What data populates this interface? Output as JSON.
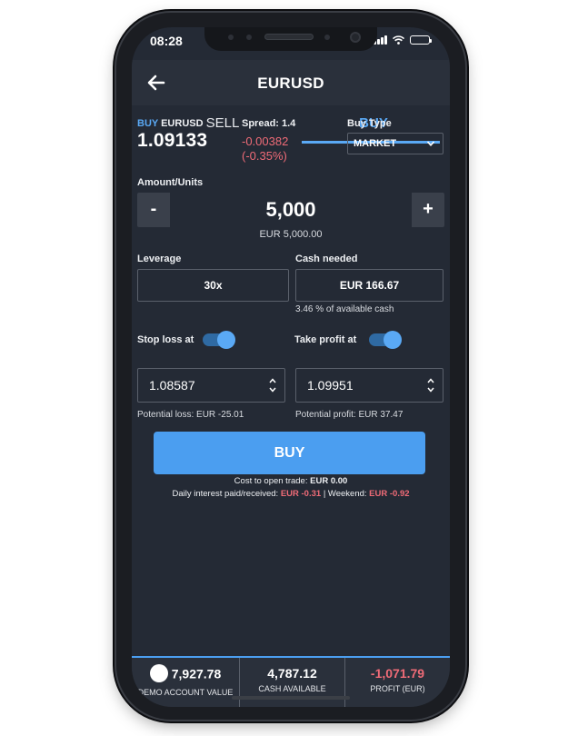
{
  "status_bar": {
    "time": "08:28"
  },
  "header": {
    "title": "EURUSD"
  },
  "tabs": [
    {
      "label": "SELL",
      "active": false
    },
    {
      "label": "BUY",
      "active": true
    }
  ],
  "instrument": {
    "side": "BUY",
    "symbol": "EURUSD",
    "price": "1.09133",
    "spread_label": "Spread: 1.4",
    "change": "-0.00382",
    "change_pct": "(-0.35%)"
  },
  "buy_type": {
    "label": "Buy Type",
    "selected": "MARKET"
  },
  "amount": {
    "label": "Amount/Units",
    "minus": "-",
    "plus": "+",
    "value": "5,000",
    "equivalent": "EUR 5,000.00"
  },
  "leverage": {
    "label": "Leverage",
    "value": "30x"
  },
  "cash_needed": {
    "label": "Cash needed",
    "value": "EUR 166.67",
    "note": "3.46 % of available cash"
  },
  "stop_loss": {
    "label": "Stop loss at",
    "enabled": true,
    "value": "1.08587",
    "potential": "Potential loss: EUR -25.01"
  },
  "take_profit": {
    "label": "Take profit at",
    "enabled": true,
    "value": "1.09951",
    "potential": "Potential profit: EUR 37.47"
  },
  "buy_button": {
    "label": "BUY"
  },
  "costs": {
    "open_label": "Cost to open trade:",
    "open_value": "EUR 0.00",
    "daily_label": "Daily interest paid/received:",
    "daily_value": "EUR -0.31",
    "separator": "|",
    "weekend_label": "Weekend:",
    "weekend_value": "EUR -0.92"
  },
  "footer": {
    "account_value": "7,927.78",
    "account_caption": "DEMO ACCOUNT VALUE",
    "cash_available": "4,787.12",
    "cash_caption": "CASH AVAILABLE",
    "profit": "-1,071.79",
    "profit_caption": "PROFIT (EUR)"
  },
  "colors": {
    "accent": "#5aa9f5",
    "button": "#4b9ef0",
    "negative": "#ef6b77",
    "background": "#242a35"
  },
  "icons": [
    "back-arrow-icon",
    "chevron-down-icon",
    "spinner-arrows-icon",
    "signal-icon",
    "wifi-icon",
    "battery-icon"
  ]
}
